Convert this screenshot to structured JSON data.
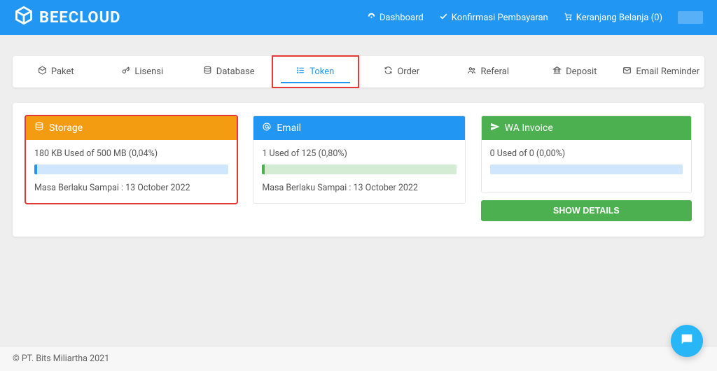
{
  "brand": {
    "name": "BEECLOUD"
  },
  "topnav": {
    "dashboard": "Dashboard",
    "konfirmasi": "Konfirmasi Pembayaran",
    "keranjang": "Keranjang Belanja (0)"
  },
  "tabs": {
    "paket": {
      "label": "Paket"
    },
    "lisensi": {
      "label": "Lisensi"
    },
    "database": {
      "label": "Database"
    },
    "token": {
      "label": "Token"
    },
    "order": {
      "label": "Order"
    },
    "referal": {
      "label": "Referal"
    },
    "deposit": {
      "label": "Deposit"
    },
    "email_reminder": {
      "label": "Email Reminder"
    }
  },
  "cards": {
    "storage": {
      "title": "Storage",
      "usage": "180 KB Used of 500 MB (0,04%)",
      "percent": 0.04,
      "expiry": "Masa Berlaku Sampai : 13 October 2022"
    },
    "email": {
      "title": "Email",
      "usage": "1 Used of 125 (0,80%)",
      "percent": 0.8,
      "expiry": "Masa Berlaku Sampai : 13 October 2022"
    },
    "wa": {
      "title": "WA Invoice",
      "usage": "0 Used of 0 (0,00%)",
      "percent": 0,
      "show_details": "SHOW DETAILS"
    }
  },
  "footer": {
    "copyright": "© PT. Bits Miliartha 2021"
  }
}
